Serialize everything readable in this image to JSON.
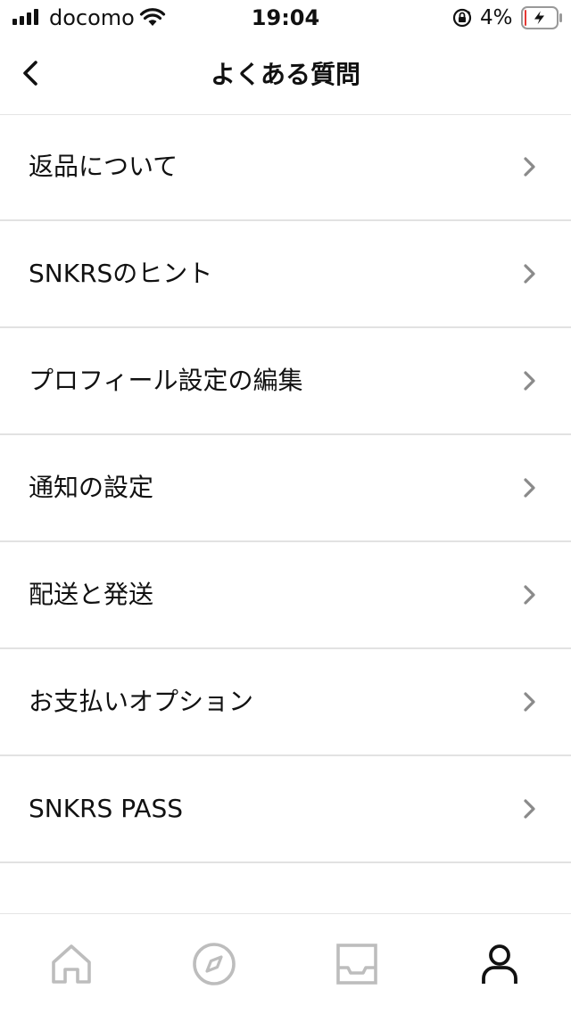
{
  "status_bar": {
    "carrier": "docomo",
    "time": "19:04",
    "battery_percent": "4%",
    "battery_level": 0.04,
    "icons": [
      "signal-icon",
      "wifi-icon",
      "orientation-lock-icon",
      "battery-charging-icon"
    ]
  },
  "header": {
    "title": "よくある質問",
    "back_icon": "chevron-left-icon"
  },
  "faq": {
    "items": [
      {
        "label": "返品について"
      },
      {
        "label": "SNKRSのヒント"
      },
      {
        "label": "プロフィール設定の編集"
      },
      {
        "label": "通知の設定"
      },
      {
        "label": "配送と発送"
      },
      {
        "label": "お支払いオプション"
      },
      {
        "label": "SNKRS PASS"
      }
    ],
    "item_icon": "chevron-right-icon"
  },
  "tab_bar": {
    "tabs": [
      {
        "icon": "home-icon",
        "active": false
      },
      {
        "icon": "compass-icon",
        "active": false
      },
      {
        "icon": "inbox-icon",
        "active": false
      },
      {
        "icon": "profile-icon",
        "active": true
      }
    ]
  },
  "colors": {
    "text": "#111111",
    "divider": "#e2e2e2",
    "chevron": "#8a8a8a",
    "tab_inactive": "#bdbdbd",
    "tab_active": "#111111",
    "battery_low": "#e53935"
  }
}
